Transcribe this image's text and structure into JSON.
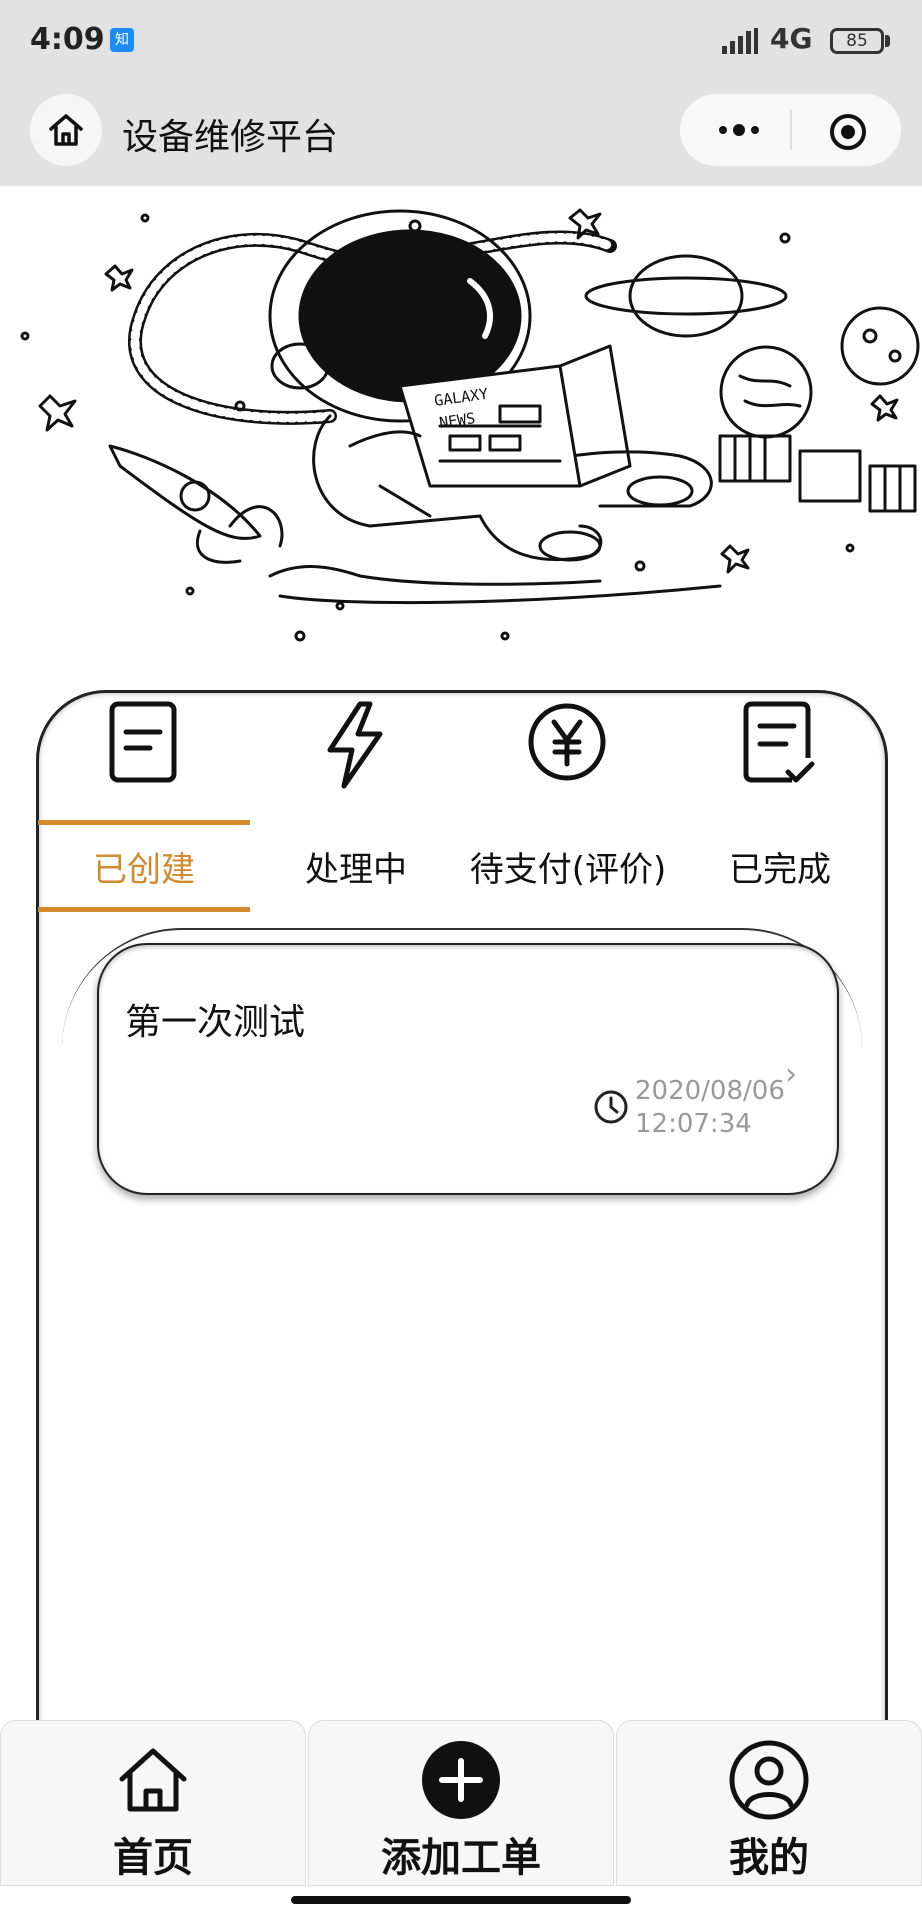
{
  "status_bar": {
    "time": "4:09",
    "app_badge": "知",
    "network": "4G",
    "battery": "85"
  },
  "nav": {
    "title": "设备维修平台",
    "home_icon": "home-icon",
    "more_icon": "more-dots-icon",
    "close_icon": "target-circle-icon"
  },
  "banner": {
    "newspaper_line1": "GALAXY",
    "newspaper_line2": "NEWS"
  },
  "categories": [
    {
      "icon": "document-icon"
    },
    {
      "icon": "lightning-icon"
    },
    {
      "icon": "yen-circle-icon"
    },
    {
      "icon": "document-check-icon"
    }
  ],
  "tabs": [
    {
      "label": "已创建",
      "active": true
    },
    {
      "label": "处理中",
      "active": false
    },
    {
      "label": "待支付(评价)",
      "active": false
    },
    {
      "label": "已完成",
      "active": false
    }
  ],
  "orders": [
    {
      "title": "第一次测试",
      "date": "2020/08/06",
      "time": "12:07:34",
      "arrow": "›"
    }
  ],
  "tabbar": [
    {
      "label": "首页",
      "icon": "home-icon"
    },
    {
      "label": "添加工单",
      "icon": "plus-circle-icon"
    },
    {
      "label": "我的",
      "icon": "user-circle-icon"
    }
  ],
  "colors": {
    "accent": "#d38a2c",
    "topbar": "#e2e2e2",
    "muted_text": "#999999"
  }
}
